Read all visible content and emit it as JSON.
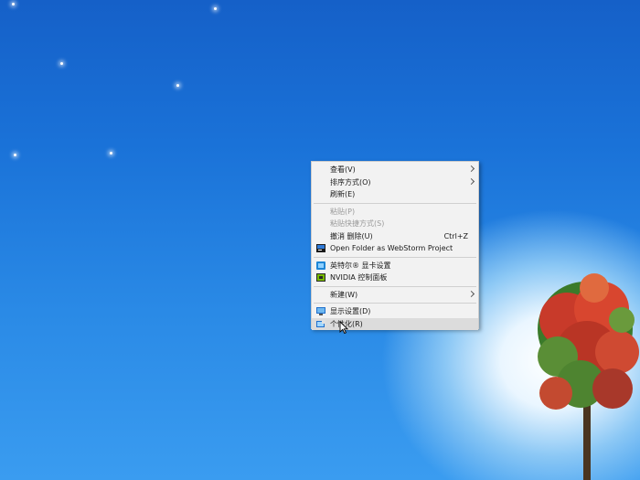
{
  "context_menu": {
    "items": [
      {
        "label": "查看(V)"
      },
      {
        "label": "排序方式(O)"
      },
      {
        "label": "刷新(E)"
      },
      {
        "label": "粘贴(P)"
      },
      {
        "label": "粘贴快捷方式(S)"
      },
      {
        "label": "撤消 删除(U)",
        "shortcut": "Ctrl+Z"
      },
      {
        "label": "Open Folder as WebStorm Project"
      },
      {
        "label": "英特尔® 显卡设置"
      },
      {
        "label": "NVIDIA 控制面板"
      },
      {
        "label": "新建(W)"
      },
      {
        "label": "显示设置(D)"
      },
      {
        "label": "个性化(R)"
      }
    ]
  },
  "icons": {
    "webstorm": "webstorm-icon",
    "intel": "intel-graphics-icon",
    "nvidia": "nvidia-icon",
    "display": "display-settings-icon",
    "personalize": "personalize-icon"
  },
  "colors": {
    "menu_bg": "#f2f2f2",
    "hover_bg": "#dcdcdc",
    "disabled_text": "#9a9a9a",
    "desktop_blue": "#1a72d8"
  }
}
